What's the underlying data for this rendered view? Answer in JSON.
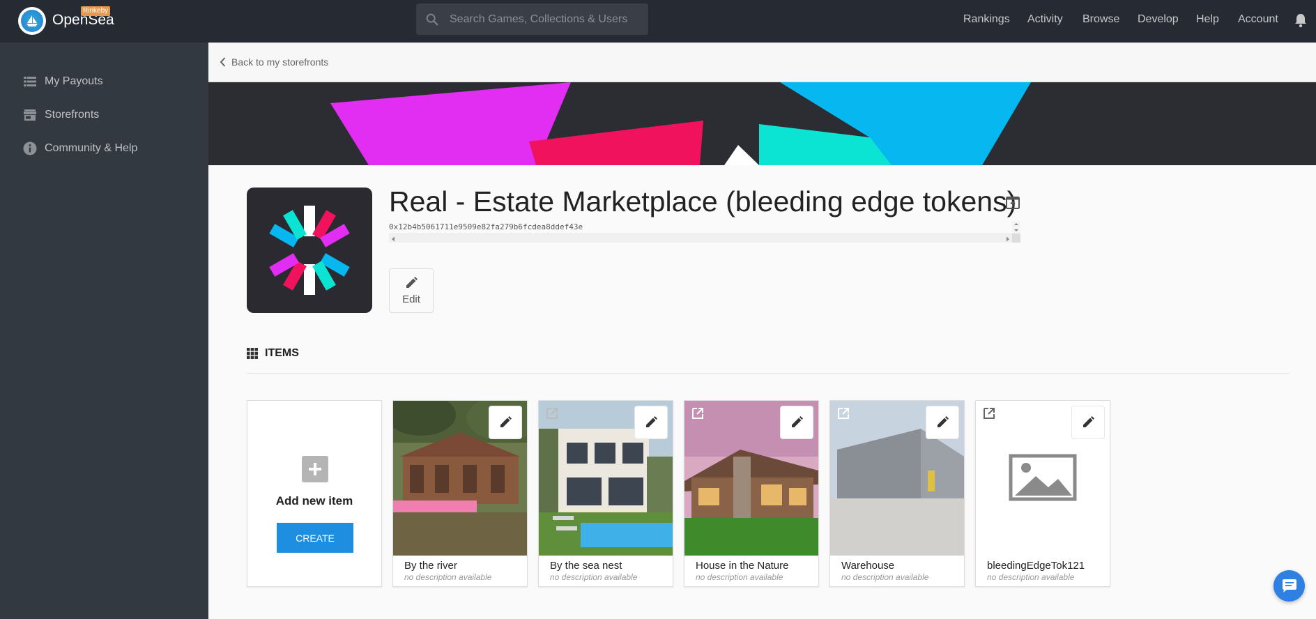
{
  "topbar": {
    "brand": "OpenSea",
    "network_badge": "Rinkeby",
    "search_placeholder": "Search Games, Collections & Users",
    "nav": [
      "Rankings",
      "Activity",
      "Browse",
      "Develop",
      "Help",
      "Account"
    ]
  },
  "sidebar": {
    "items": [
      {
        "label": "My Payouts",
        "icon": "list-icon"
      },
      {
        "label": "Storefronts",
        "icon": "store-icon"
      },
      {
        "label": "Community & Help",
        "icon": "info-icon"
      }
    ]
  },
  "main": {
    "back_label": "Back to my storefronts",
    "store_title": "Real - Estate Marketplace (bleeding edge tokens)",
    "address": "0x12b4b5061711e9509e82fa279b6fcdea8ddef43e",
    "edit_label": "Edit",
    "items_heading": "ITEMS"
  },
  "add_card": {
    "label": "Add new item",
    "create_label": "CREATE"
  },
  "items": [
    {
      "name": "By the river",
      "description": "no description available",
      "image": "house-river"
    },
    {
      "name": "By the sea nest",
      "description": "no description available",
      "image": "house-pool"
    },
    {
      "name": "House in the Nature",
      "description": "no description available",
      "image": "house-nature"
    },
    {
      "name": "Warehouse",
      "description": "no description available",
      "image": "warehouse"
    },
    {
      "name": "bleedingEdgeTok121",
      "description": "no description available",
      "image": "image-placeholder-icon"
    }
  ],
  "colors": {
    "topbar": "#262b33",
    "sidebar": "#333941",
    "accent": "#1e8fe0",
    "badge": "#e8984e"
  }
}
